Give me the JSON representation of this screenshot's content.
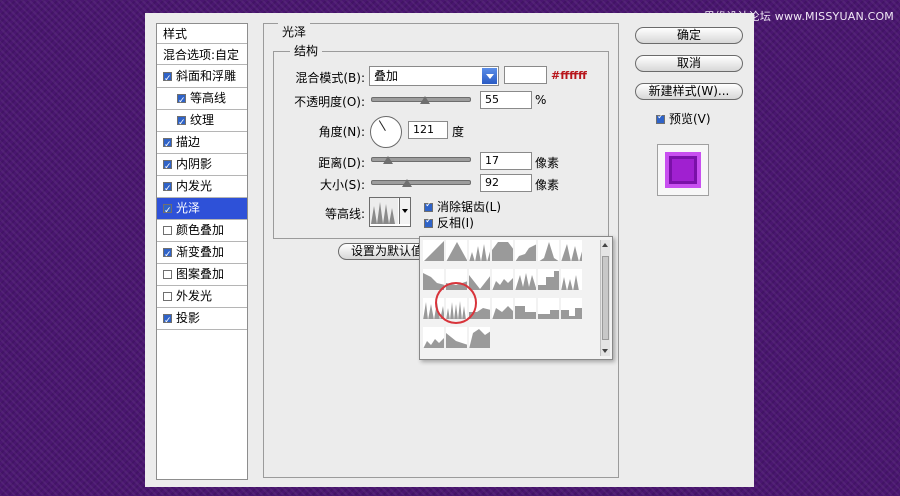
{
  "watermark": "思缘设计论坛 www.MISSYUAN.COM",
  "styles_panel": {
    "title": "样式",
    "blend_options": "混合选项:自定",
    "items": [
      {
        "label": "斜面和浮雕",
        "checked": true,
        "indent": false,
        "selected": false
      },
      {
        "label": "等高线",
        "checked": true,
        "indent": true,
        "selected": false
      },
      {
        "label": "纹理",
        "checked": true,
        "indent": true,
        "selected": false
      },
      {
        "label": "描边",
        "checked": true,
        "indent": false,
        "selected": false
      },
      {
        "label": "内阴影",
        "checked": true,
        "indent": false,
        "selected": false
      },
      {
        "label": "内发光",
        "checked": true,
        "indent": false,
        "selected": false
      },
      {
        "label": "光泽",
        "checked": true,
        "indent": false,
        "selected": true
      },
      {
        "label": "颜色叠加",
        "checked": false,
        "indent": false,
        "selected": false
      },
      {
        "label": "渐变叠加",
        "checked": true,
        "indent": false,
        "selected": false
      },
      {
        "label": "图案叠加",
        "checked": false,
        "indent": false,
        "selected": false
      },
      {
        "label": "外发光",
        "checked": false,
        "indent": false,
        "selected": false
      },
      {
        "label": "投影",
        "checked": true,
        "indent": false,
        "selected": false
      }
    ]
  },
  "satin": {
    "section_title": "光泽",
    "structure_title": "结构",
    "blend_mode_label": "混合模式(B):",
    "blend_mode_value": "叠加",
    "color_hex": "#ffffff",
    "color_swatch": "#ffffff",
    "opacity_label": "不透明度(O):",
    "opacity_value": "55",
    "opacity_unit": "%",
    "opacity_level": 0.55,
    "angle_label": "角度(N):",
    "angle_value": "121",
    "angle_unit": "度",
    "distance_label": "距离(D):",
    "distance_value": "17",
    "distance_unit": "像素",
    "distance_level": 0.17,
    "size_label": "大小(S):",
    "size_value": "92",
    "size_unit": "像素",
    "size_level": 0.37,
    "contour_label": "等高线:",
    "antialias_label": "消除锯齿(L)",
    "antialias_checked": true,
    "invert_label": "反相(I)",
    "invert_checked": true,
    "default_button": "设置为默认值"
  },
  "buttons": {
    "ok": "确定",
    "cancel": "取消",
    "new_style": "新建样式(W)...",
    "preview_label": "预览(V)",
    "preview_checked": true
  },
  "colors": {
    "selection": "#2e51d8",
    "hex_text": "#b8151b",
    "highlight_ring": "#d8343b",
    "preview_fill": "#a020d0"
  },
  "contour_presets": [
    "linear",
    "cone",
    "ring",
    "half-round",
    "rolling-slope",
    "gaussian",
    "sawtooth",
    "cove-deep",
    "cove-shallow",
    "inverse-cone",
    "bumps",
    "double-ring",
    "stair",
    "ring-double",
    "triple-ring",
    "ring-triple",
    "shallow-slope",
    "valley",
    "notch",
    "low-notch",
    "step-notch",
    "wave",
    "peak-left",
    "hump"
  ],
  "selected_contour": "ring-triple"
}
